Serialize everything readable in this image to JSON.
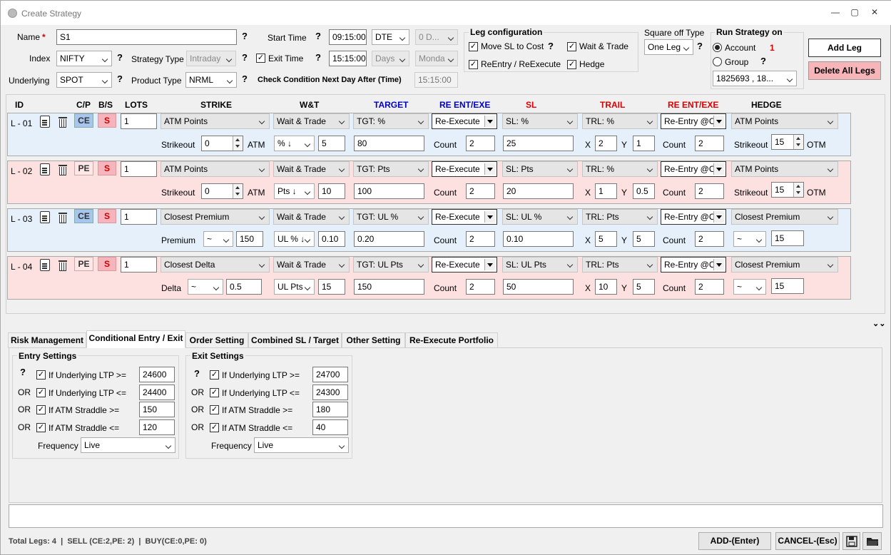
{
  "window": {
    "title": "Create Strategy",
    "minimize": "—",
    "maximize": "▢",
    "close": "✕"
  },
  "top": {
    "name_label": "Name",
    "required_mark": "*",
    "name_value": "S1",
    "q": "?",
    "index_label": "Index",
    "index_value": "NIFTY",
    "underlying_label": "Underlying",
    "underlying_value": "SPOT",
    "start_time_label": "Start Time",
    "start_time_value": "09:15:00",
    "dte_value": "DTE",
    "dte_days_value": "0 D...",
    "strategy_type_label": "Strategy Type",
    "strategy_type_value": "Intraday",
    "exit_time_label": "Exit Time",
    "exit_time_value": "15:15:00",
    "days_value": "Days",
    "monday_value": "Monda",
    "product_type_label": "Product Type",
    "product_type_value": "NRML",
    "check_condition_label": "Check Condition Next Day After (Time)",
    "check_condition_value": "15:15:00"
  },
  "leg_config": {
    "title": "Leg configuration",
    "move_sl": "Move SL to Cost",
    "wait_trade": "Wait & Trade",
    "reentry": "ReEntry / ReExecute",
    "hedge": "Hedge",
    "q": "?"
  },
  "square_off": {
    "label": "Square off Type",
    "value": "One Leg"
  },
  "run_on": {
    "title": "Run Strategy on",
    "account": "Account",
    "account_count": "1",
    "group": "Group",
    "account_value": "1825693 , 18..."
  },
  "buttons": {
    "add_leg": "Add Leg",
    "delete_all": "Delete All Legs",
    "add": "ADD-(Enter)",
    "cancel": "CANCEL-(Esc)"
  },
  "columns": {
    "id": "ID",
    "cp": "C/P",
    "bs": "B/S",
    "lots": "LOTS",
    "strike": "STRIKE",
    "wt": "W&T",
    "target": "TARGET",
    "reent1": "RE ENT/EXE",
    "sl": "SL",
    "trail": "TRAIL",
    "reent2": "RE ENT/EXE",
    "hedge": "HEDGE"
  },
  "legs": [
    {
      "id": "L - 01",
      "cp": "CE",
      "bs": "S",
      "lots": "1",
      "strike": "ATM Points",
      "wt": "Wait & Trade",
      "target": "TGT: %",
      "reexec": "Re-Execute",
      "sl": "SL: %",
      "trail": "TRL: %",
      "reentry": "Re-Entry @C",
      "hedge": "ATM Points",
      "sub_label": "Strikeout",
      "sub_value": "0",
      "sub_suffix": "ATM",
      "wt_mode": "% ↓",
      "wt_value": "5",
      "target_value": "80",
      "count_label": "Count",
      "count1": "2",
      "sl_value": "25",
      "x_label": "X",
      "x_value": "2",
      "y_label": "Y",
      "y_value": "1",
      "count2": "2",
      "hedge_label": "Strikeout",
      "hedge_value": "15",
      "hedge_suffix": "OTM"
    },
    {
      "id": "L - 02",
      "cp": "PE",
      "bs": "S",
      "lots": "1",
      "strike": "ATM Points",
      "wt": "Wait & Trade",
      "target": "TGT: Pts",
      "reexec": "Re-Execute",
      "sl": "SL: Pts",
      "trail": "TRL: %",
      "reentry": "Re-Entry @C",
      "hedge": "ATM Points",
      "sub_label": "Strikeout",
      "sub_value": "0",
      "sub_suffix": "ATM",
      "wt_mode": "Pts ↓",
      "wt_value": "10",
      "target_value": "100",
      "count_label": "Count",
      "count1": "2",
      "sl_value": "20",
      "x_label": "X",
      "x_value": "1",
      "y_label": "Y",
      "y_value": "0.5",
      "count2": "2",
      "hedge_label": "Strikeout",
      "hedge_value": "15",
      "hedge_suffix": "OTM"
    },
    {
      "id": "L - 03",
      "cp": "CE",
      "bs": "S",
      "lots": "1",
      "strike": "Closest Premium",
      "wt": "Wait & Trade",
      "target": "TGT: UL %",
      "reexec": "Re-Execute",
      "sl": "SL: UL %",
      "trail": "TRL: Pts",
      "reentry": "Re-Entry @C",
      "hedge": "Closest Premium",
      "sub_label": "Premium",
      "sub_mode": "~",
      "sub_value": "150",
      "wt_mode": "UL % ↓",
      "wt_value": "0.10",
      "target_value": "0.20",
      "count_label": "Count",
      "count1": "2",
      "sl_value": "0.10",
      "x_label": "X",
      "x_value": "5",
      "y_label": "Y",
      "y_value": "5",
      "count2": "2",
      "hedge_mode": "~",
      "hedge_value": "15"
    },
    {
      "id": "L - 04",
      "cp": "PE",
      "bs": "S",
      "lots": "1",
      "strike": "Closest Delta",
      "wt": "Wait & Trade",
      "target": "TGT: UL Pts",
      "reexec": "Re-Execute",
      "sl": "SL: UL Pts",
      "trail": "TRL: Pts",
      "reentry": "Re-Entry @C",
      "hedge": "Closest Premium",
      "sub_label": "Delta",
      "sub_mode": "~",
      "sub_value": "0.5",
      "wt_mode": "UL Pts",
      "wt_value": "15",
      "target_value": "150",
      "count_label": "Count",
      "count1": "2",
      "sl_value": "50",
      "x_label": "X",
      "x_value": "10",
      "y_label": "Y",
      "y_value": "5",
      "count2": "2",
      "hedge_mode": "~",
      "hedge_value": "15"
    }
  ],
  "tabs": [
    "Risk Management",
    "Conditional Entry / Exit",
    "Order Setting",
    "Combined SL / Target",
    "Other Setting",
    "Re-Execute Portfolio"
  ],
  "entry": {
    "title": "Entry Settings",
    "q": "?",
    "or": "OR",
    "rows": [
      {
        "label": "If Underlying LTP >=",
        "value": "24600"
      },
      {
        "label": "If Underlying LTP <=",
        "value": "24400"
      },
      {
        "label": "If ATM Straddle >=",
        "value": "150"
      },
      {
        "label": "If ATM Straddle <=",
        "value": "120"
      }
    ],
    "freq_label": "Frequency",
    "freq_value": "Live"
  },
  "exit": {
    "title": "Exit Settings",
    "q": "?",
    "or": "OR",
    "rows": [
      {
        "label": "If Underlying LTP >=",
        "value": "24700"
      },
      {
        "label": "If Underlying LTP <=",
        "value": "24300"
      },
      {
        "label": "If ATM Straddle >=",
        "value": "180"
      },
      {
        "label": "If ATM Straddle <=",
        "value": "40"
      }
    ],
    "freq_label": "Frequency",
    "freq_value": "Live"
  },
  "status": {
    "text": "Total Legs: 4  |  SELL (CE:2,PE: 2)  |  BUY(CE:0,PE: 0)"
  },
  "check": "✓"
}
